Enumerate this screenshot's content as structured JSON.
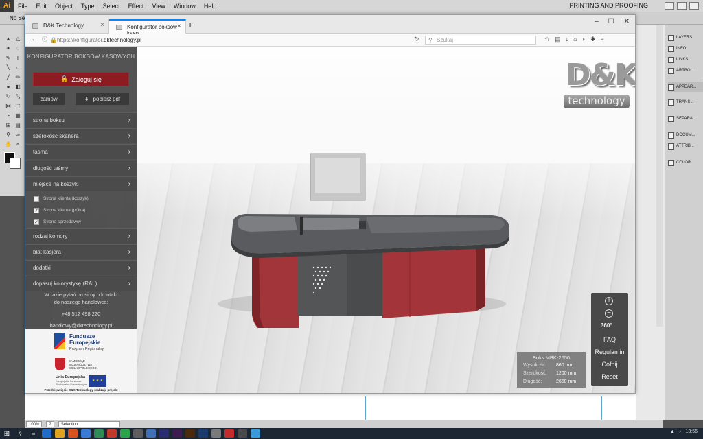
{
  "illustrator": {
    "menus": [
      "File",
      "Edit",
      "Object",
      "Type",
      "Select",
      "Effect",
      "View",
      "Window",
      "Help"
    ],
    "workspace": "PRINTING AND PROOFING",
    "control_text": "No Selection",
    "panels": [
      "LAYERS",
      "INFO",
      "LINKS",
      "ARTBO...",
      "APPEAR...",
      "TRANS...",
      "SEPARA...",
      "DOCUM...",
      "ATTRIB...",
      "COLOR"
    ],
    "status": {
      "zoom": "100%",
      "page": "2",
      "mode": "Selection"
    }
  },
  "browser": {
    "tabs": [
      {
        "title": "D&K Technology",
        "active": false
      },
      {
        "title": "Konfigurator boksów kaso",
        "active": true
      }
    ],
    "url_prefix": "https://konfigurator.",
    "url_domain": "dktechnology.pl",
    "search_placeholder": "Szukaj"
  },
  "sidebar": {
    "title": "KONFIGURATOR BOKSÓW KASOWYCH",
    "login_label": "Zaloguj się",
    "order_label": "zamów",
    "pdf_label": "pobierz pdf",
    "sections_top": [
      "strona boksu",
      "szerokość skanera",
      "taśma",
      "długość taśmy",
      "miejsce na koszyki"
    ],
    "checkboxes": [
      {
        "label": "Strona klienta (koszyk)",
        "checked": false
      },
      {
        "label": "Strona klienta (półka)",
        "checked": true
      },
      {
        "label": "Strona sprzedawcy",
        "checked": true
      }
    ],
    "sections_bottom": [
      "rodzaj komory",
      "blat kasjera",
      "dodatki",
      "dopasuj kolorystykę (RAL)"
    ],
    "contact_line1": "W razie pytań prosimy o kontakt",
    "contact_line2": "do naszego handlowca:",
    "phone": "+48 512 498 220",
    "email": "handlowy@dktechnology.pl"
  },
  "eu_logos": {
    "fe_name_1": "Fundusze",
    "fe_name_2": "Europejskie",
    "fe_sub": "Program Regionalny",
    "crest_text": "SAMORZĄD WOJEWÓDZTWA WIELKOPOLSKIEGO",
    "ue_name": "Unia Europejska",
    "ue_sub": "Europejskie Fundusze Strukturalne i Inwestycyjne",
    "footer": "Przedsięwzięcie D&K Technology realizuje projekt"
  },
  "brand": {
    "logo_main": "D&K",
    "logo_sub": "technology"
  },
  "viewer_controls": {
    "zoom_in": "+",
    "zoom_out": "−",
    "rotate": "360°",
    "links": [
      "FAQ",
      "Regulamin",
      "Cofnij",
      "Reset"
    ]
  },
  "product_info": {
    "title": "Boks MBK-2650",
    "rows": [
      {
        "label": "Wysokość:",
        "value": "860 mm"
      },
      {
        "label": "Szerokość:",
        "value": "1200 mm"
      },
      {
        "label": "Długość:",
        "value": "2650 mm"
      }
    ]
  },
  "system": {
    "time": "13:56"
  },
  "colors": {
    "accent_red": "#8c1c22",
    "counter_red": "#a0353a",
    "sidebar_bg": "#464646"
  }
}
